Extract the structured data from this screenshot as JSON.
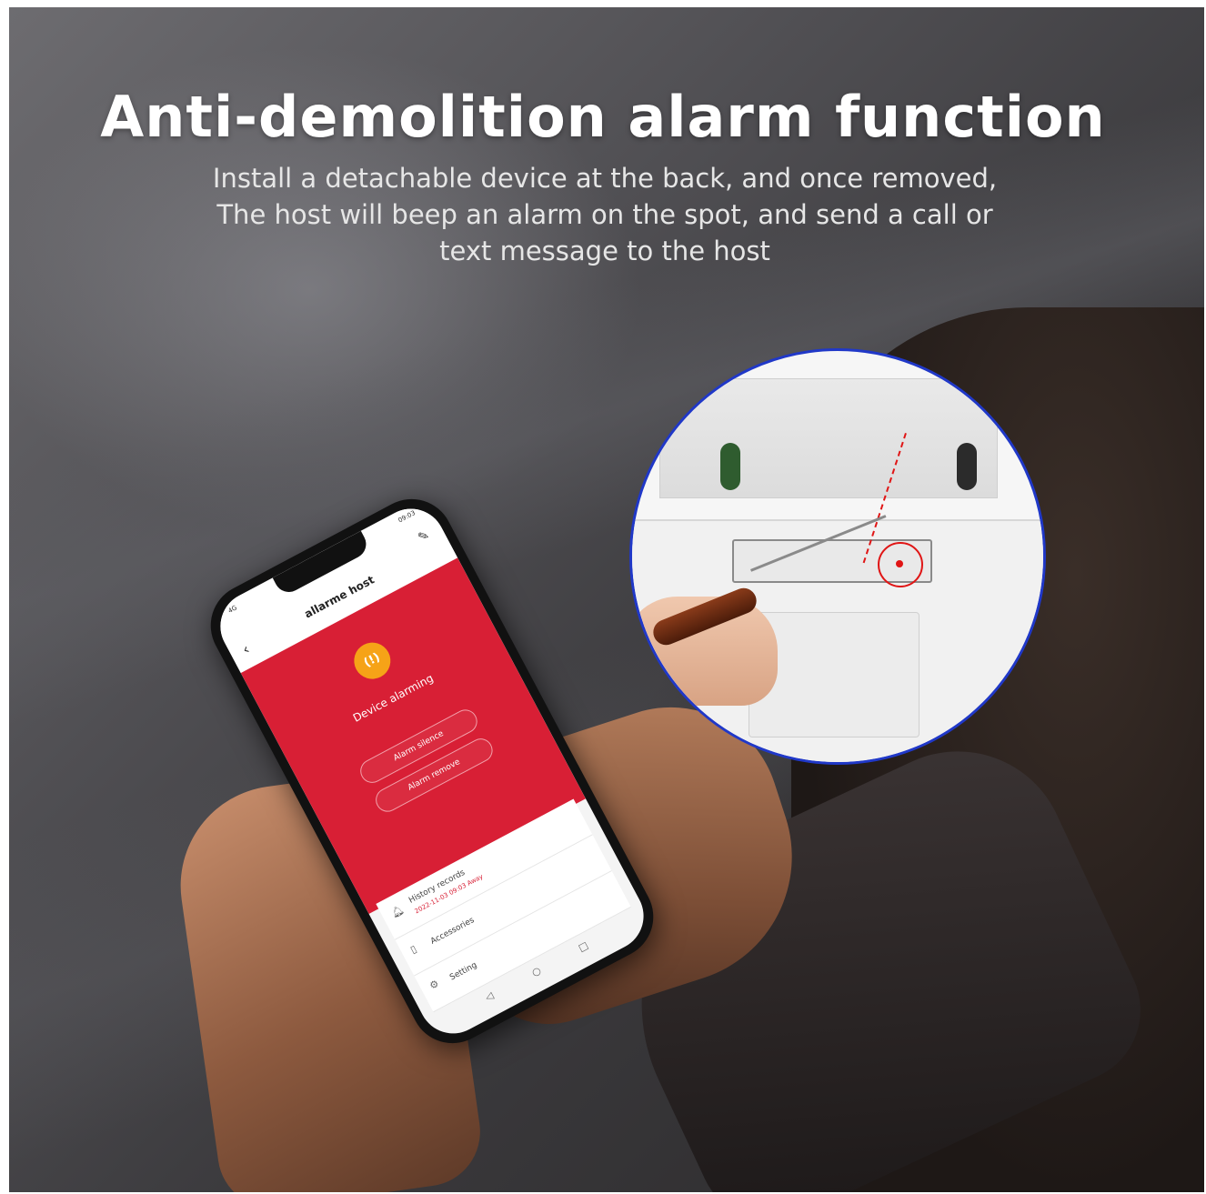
{
  "headline": {
    "title": "Anti-demolition alarm function",
    "subtitle_lines": [
      "Install a detachable device at the back, and once removed,",
      "The host will beep an alarm on the spot, and send a call or",
      "text message to the host"
    ]
  },
  "phone": {
    "status": {
      "time": "09:03",
      "signal": "4G"
    },
    "app_title": "allarme host",
    "alarm": {
      "state": "Device alarming",
      "icon": "alarm-bell-icon",
      "buttons": {
        "silence": "Alarm silence",
        "remove": "Alarm remove"
      },
      "panel_color": "#d81f35",
      "icon_color": "#f6a317"
    },
    "menu": {
      "history": {
        "label": "History records",
        "detail": "2022-11-03 09:03 Away"
      },
      "accessories": {
        "label": "Accessories"
      },
      "setting": {
        "label": "Setting"
      }
    },
    "nav": {
      "back": "◁",
      "home": "○",
      "recent": "□"
    }
  },
  "inset": {
    "ring_color": "#2038c8",
    "marker_color": "#e01515"
  }
}
